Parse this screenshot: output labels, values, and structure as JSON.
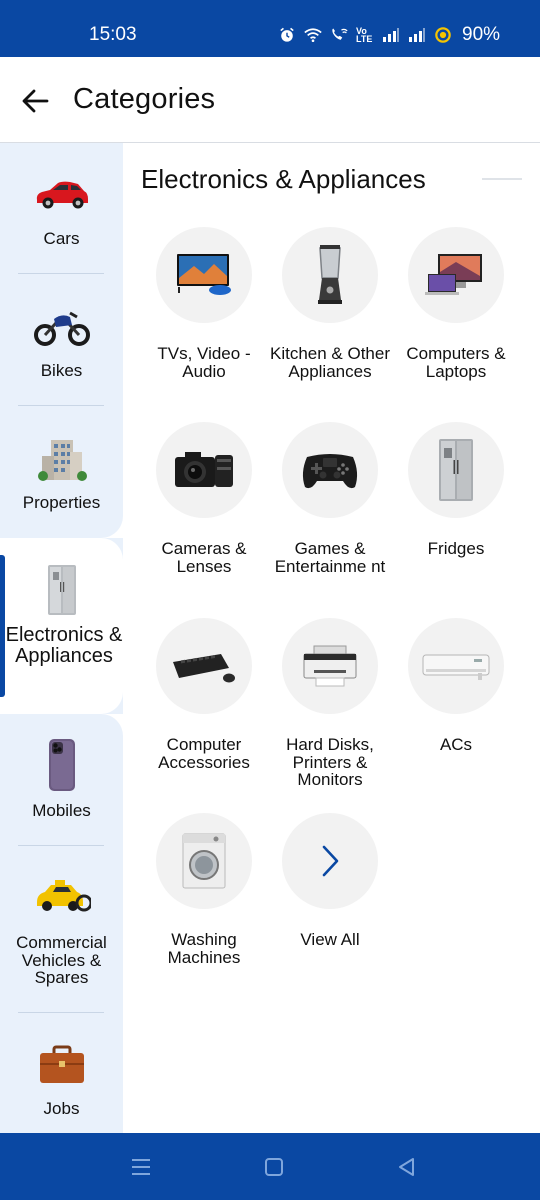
{
  "status_bar": {
    "time": "15:03",
    "net_label": "Vo LTE",
    "battery": "90%"
  },
  "header": {
    "title": "Categories"
  },
  "sidebar": {
    "items": [
      {
        "label": "Cars",
        "icon": "car-icon"
      },
      {
        "label": "Bikes",
        "icon": "motorbike-icon"
      },
      {
        "label": "Properties",
        "icon": "building-icon"
      },
      {
        "label": "Electronics & Appliances",
        "icon": "fridge-icon",
        "active": true
      },
      {
        "label": "Mobiles",
        "icon": "smartphone-icon"
      },
      {
        "label": "Commercial Vehicles & Spares",
        "icon": "taxi-icon"
      },
      {
        "label": "Jobs",
        "icon": "briefcase-icon"
      }
    ]
  },
  "main": {
    "section_title": "Electronics & Appliances",
    "tiles": [
      {
        "label": "TVs, Video - Audio",
        "icon": "tv-icon"
      },
      {
        "label": "Kitchen & Other Appliances",
        "icon": "blender-icon"
      },
      {
        "label": "Computers & Laptops",
        "icon": "laptop-icon"
      },
      {
        "label": "Cameras & Lenses",
        "icon": "camera-icon"
      },
      {
        "label": "Games & Entertainme nt",
        "icon": "gamepad-icon"
      },
      {
        "label": "Fridges",
        "icon": "fridge-icon"
      },
      {
        "label": "Computer Accessories",
        "icon": "keyboard-icon"
      },
      {
        "label": "Hard Disks, Printers & Monitors",
        "icon": "printer-icon"
      },
      {
        "label": "ACs",
        "icon": "air-conditioner-icon"
      },
      {
        "label": "Washing Machines",
        "icon": "washing-machine-icon"
      },
      {
        "label": "View All",
        "icon": "chevron-right-icon"
      }
    ]
  },
  "colors": {
    "brand": "#0a48a3",
    "sidebar_bg": "#e9f1fb",
    "tile_bg": "#f2f2f2"
  }
}
